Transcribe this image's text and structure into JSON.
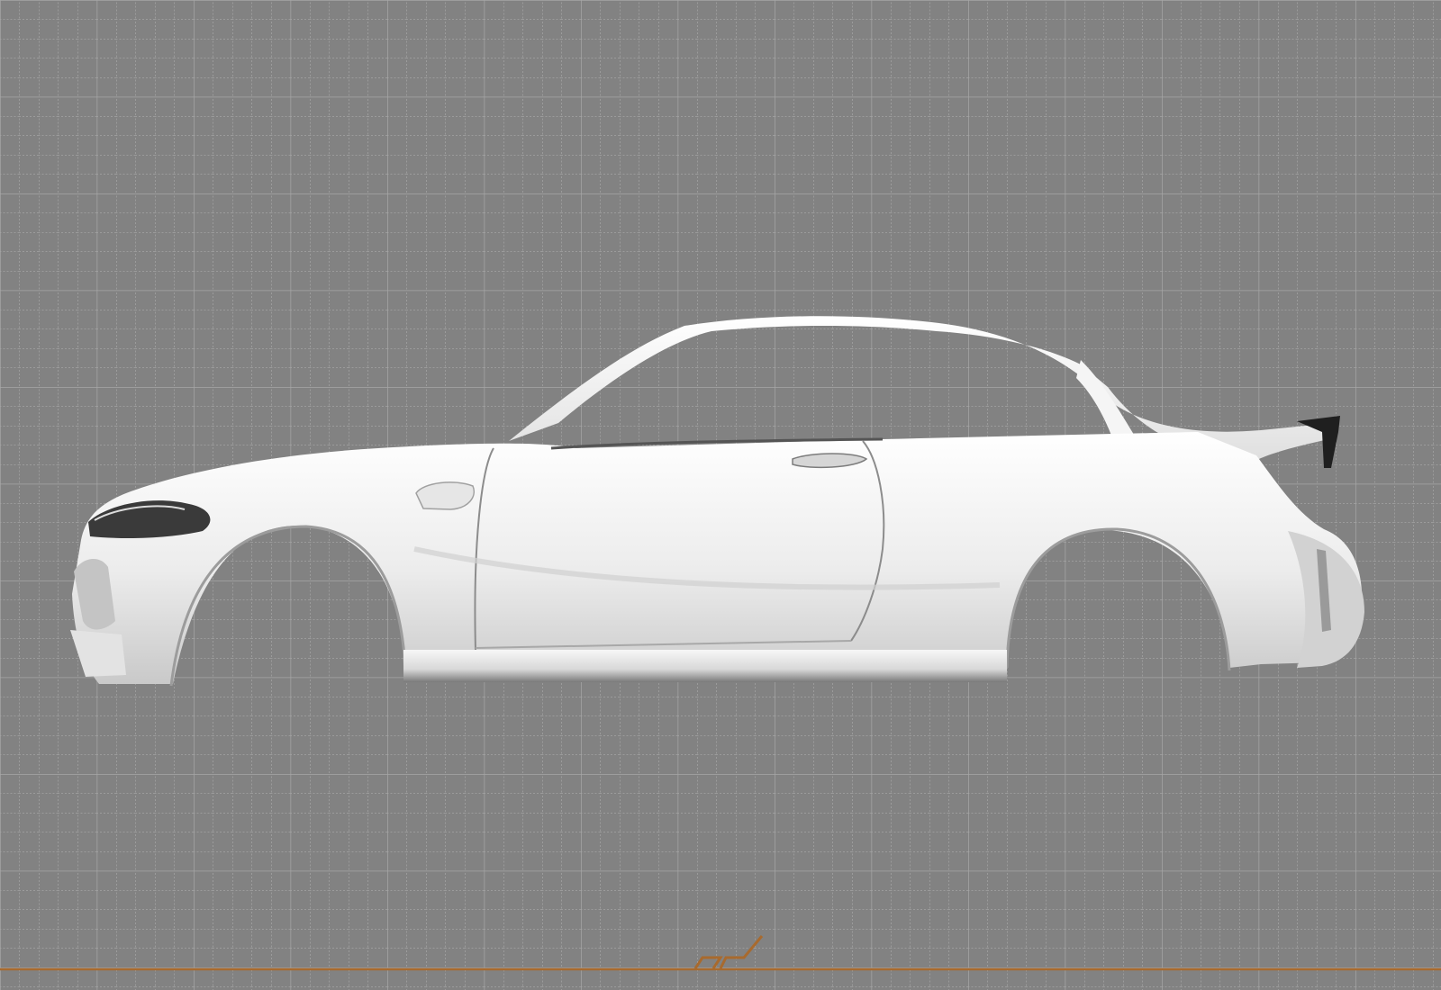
{
  "canvas": {
    "background": "#828282",
    "grid_minor_color": "#b4b4b4",
    "grid_major_color": "#a6a6a6",
    "body_color": "#f2f2f2",
    "body_shadow": "#b9b9b9",
    "accent": "#a86a2e"
  },
  "subject": {
    "icon": "car-side-silhouette-icon"
  },
  "footer": {
    "icon": "brand-mark-icon"
  }
}
